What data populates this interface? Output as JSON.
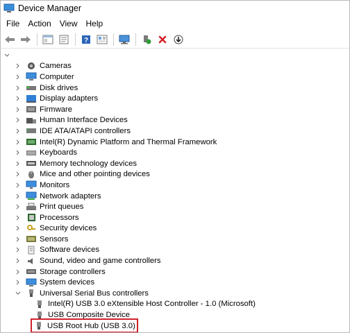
{
  "window": {
    "title": "Device Manager"
  },
  "menu": [
    "File",
    "Action",
    "View",
    "Help"
  ],
  "toolbar": {
    "buttons": [
      "back-icon",
      "forward-icon",
      "show-hide-tree-icon",
      "properties-icon",
      "help-icon",
      "update-driver-icon",
      "scan-hardware-icon",
      "enable-device-icon",
      "uninstall-icon",
      "download-driver-icon"
    ]
  },
  "tree": {
    "categories": [
      {
        "label": "Cameras",
        "icon": "camera-icon"
      },
      {
        "label": "Computer",
        "icon": "computer-icon"
      },
      {
        "label": "Disk drives",
        "icon": "disk-drive-icon"
      },
      {
        "label": "Display adapters",
        "icon": "display-adapter-icon"
      },
      {
        "label": "Firmware",
        "icon": "firmware-icon"
      },
      {
        "label": "Human Interface Devices",
        "icon": "hid-icon"
      },
      {
        "label": "IDE ATA/ATAPI controllers",
        "icon": "ide-icon"
      },
      {
        "label": "Intel(R) Dynamic Platform and Thermal Framework",
        "icon": "thermal-icon"
      },
      {
        "label": "Keyboards",
        "icon": "keyboard-icon"
      },
      {
        "label": "Memory technology devices",
        "icon": "memory-icon"
      },
      {
        "label": "Mice and other pointing devices",
        "icon": "mouse-icon"
      },
      {
        "label": "Monitors",
        "icon": "monitor-icon"
      },
      {
        "label": "Network adapters",
        "icon": "network-icon"
      },
      {
        "label": "Print queues",
        "icon": "printer-icon"
      },
      {
        "label": "Processors",
        "icon": "processor-icon"
      },
      {
        "label": "Security devices",
        "icon": "security-icon"
      },
      {
        "label": "Sensors",
        "icon": "sensor-icon"
      },
      {
        "label": "Software devices",
        "icon": "software-icon"
      },
      {
        "label": "Sound, video and game controllers",
        "icon": "sound-icon"
      },
      {
        "label": "Storage controllers",
        "icon": "storage-icon"
      },
      {
        "label": "System devices",
        "icon": "system-icon"
      }
    ],
    "usb": {
      "label": "Universal Serial Bus controllers",
      "icon": "usb-icon",
      "expanded": true,
      "children": [
        {
          "label": "Intel(R) USB 3.0 eXtensible Host Controller - 1.0 (Microsoft)",
          "icon": "usb-device-icon"
        },
        {
          "label": "USB Composite Device",
          "icon": "usb-device-icon"
        },
        {
          "label": "USB Root Hub (USB 3.0)",
          "icon": "usb-device-icon",
          "highlighted": true
        }
      ]
    }
  },
  "colors": {
    "highlight": "#d0202b",
    "accent": "#1f6fc5"
  }
}
